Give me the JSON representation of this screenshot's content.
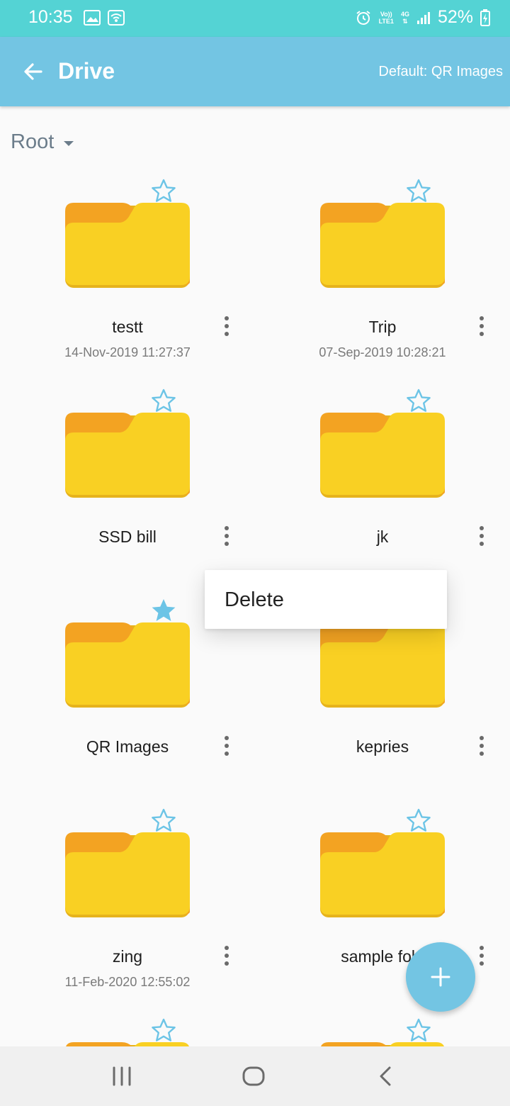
{
  "status_bar": {
    "time": "10:35",
    "network": "4G",
    "lte_line1": "Vo))",
    "lte_line2": "LTE1",
    "battery": "52%"
  },
  "app_bar": {
    "title": "Drive",
    "default_label": "Default: QR Images"
  },
  "breadcrumb": {
    "label": "Root"
  },
  "folders": [
    {
      "name": "testt",
      "date": "14-Nov-2019 11:27:37",
      "starred": false
    },
    {
      "name": "Trip",
      "date": "07-Sep-2019 10:28:21",
      "starred": false
    },
    {
      "name": "SSD bill",
      "date": "",
      "starred": false
    },
    {
      "name": "jk",
      "date": "",
      "starred": false
    },
    {
      "name": "QR Images",
      "date": "",
      "starred": true
    },
    {
      "name": "kepries",
      "date": "",
      "starred": false
    },
    {
      "name": "zing",
      "date": "11-Feb-2020 12:55:02",
      "starred": false
    },
    {
      "name": "sample fold",
      "date": "",
      "starred": false
    },
    {
      "name": "",
      "date": "",
      "starred": false
    },
    {
      "name": "",
      "date": "",
      "starred": false
    }
  ],
  "context_menu": {
    "delete_label": "Delete"
  },
  "colors": {
    "status_bar": "#54d3d4",
    "app_bar": "#73c5e3",
    "accent": "#73c5e3",
    "folder_front": "#f9d023",
    "folder_back": "#f3a322",
    "star_filled": "#6cc4e6"
  }
}
